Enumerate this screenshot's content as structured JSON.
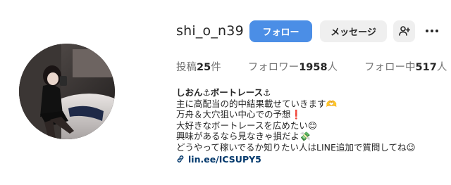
{
  "profile": {
    "username": "shi_o_n39",
    "follow_label": "フォロー",
    "message_label": "メッセージ",
    "suggest_icon": "person-add-icon",
    "more_icon": "more-horizontal-icon"
  },
  "stats": {
    "posts_label": "投稿",
    "posts_count": "25",
    "posts_unit": "件",
    "followers_label": "フォロワー",
    "followers_count": "1958",
    "followers_unit": "人",
    "following_label": "フォロー中",
    "following_count": "517",
    "following_unit": "人"
  },
  "bio": {
    "display_name": "しおん⚓ボートレース⚓",
    "lines": [
      "主に高配当の的中結果載せていきます🫶",
      "万舟＆大穴狙い中心での予想❗",
      "大好きなボートレースを広めたい😊",
      "興味があるなら見なきゃ損だよ💸",
      "どうやって稼いでるか知りたい人はLINE追加で質問してね😉"
    ],
    "link_icon": "link-icon",
    "link_text": "lin.ee/ICSUPY5"
  },
  "colors": {
    "follow_button": "#4b8ee6",
    "secondary_button": "#efefef",
    "link": "#00376b"
  }
}
